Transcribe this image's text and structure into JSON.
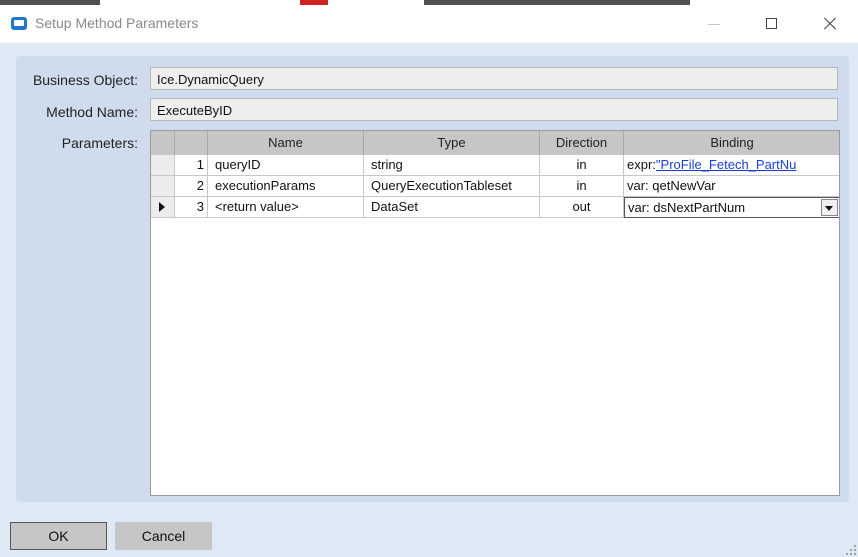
{
  "window": {
    "title": "Setup Method Parameters"
  },
  "form": {
    "business_object_label": "Business Object:",
    "business_object_value": "Ice.DynamicQuery",
    "method_name_label": "Method Name:",
    "method_name_value": "ExecuteByID",
    "parameters_label": "Parameters:"
  },
  "grid": {
    "columns": [
      "Name",
      "Type",
      "Direction",
      "Binding"
    ],
    "rows": [
      {
        "num": "1",
        "name": "queryID",
        "type": "string",
        "direction": "in",
        "binding_prefix": "expr:",
        "binding_value": "\"ProFile_Fetech_PartNu"
      },
      {
        "num": "2",
        "name": "executionParams",
        "type": "QueryExecutionTableset",
        "direction": "in",
        "binding_prefix": "var:",
        "binding_value": "qetNewVar"
      },
      {
        "num": "3",
        "name": "<return value>",
        "type": "DataSet",
        "direction": "out",
        "binding_prefix": "var:",
        "binding_value": "dsNextPartNum"
      }
    ]
  },
  "buttons": {
    "ok": "OK",
    "cancel": "Cancel"
  }
}
